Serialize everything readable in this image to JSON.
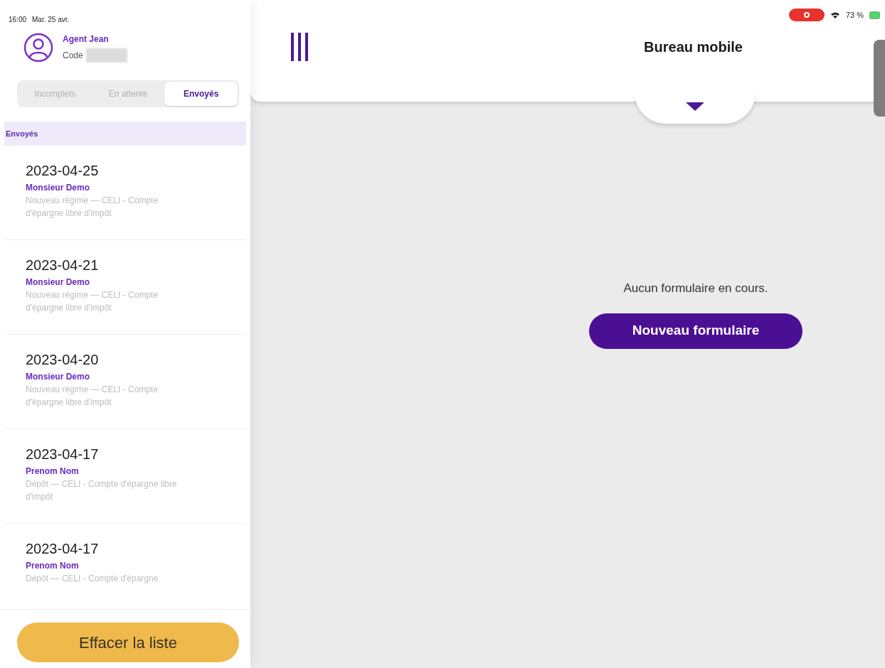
{
  "status_bar": {
    "time": "16:00",
    "date": "Mar. 25 avr.",
    "battery": "73 %"
  },
  "agent": {
    "name": "Agent Jean",
    "code_label": "Code"
  },
  "tabs": [
    {
      "label": "Incomplets",
      "selected": false
    },
    {
      "label": "En attente",
      "selected": false
    },
    {
      "label": "Envoyés",
      "selected": true
    }
  ],
  "section_header": "Envoyés",
  "items": [
    {
      "date": "2023-04-25",
      "client": "Monsieur Demo",
      "description": "Nouveau régime — CELI - Compte d'épargne libre d'impôt"
    },
    {
      "date": "2023-04-21",
      "client": "Monsieur Demo",
      "description": "Nouveau régime — CELI - Compte d'épargne libre d'impôt"
    },
    {
      "date": "2023-04-20",
      "client": "Monsieur Demo",
      "description": "Nouveau régime — CELI - Compte d'épargne libre d'impôt"
    },
    {
      "date": "2023-04-17",
      "client": "Prenom Nom",
      "description": "Dépôt — CELI - Compte d'épargne libre d'impôt"
    },
    {
      "date": "2023-04-17",
      "client": "Prenom Nom",
      "description": "Dépôt — CELI - Compte d'épargne"
    }
  ],
  "clear_button": "Effacer la liste",
  "header": {
    "title": "Bureau mobile"
  },
  "empty_message": "Aucun formulaire en cours.",
  "new_button": "Nouveau formulaire"
}
